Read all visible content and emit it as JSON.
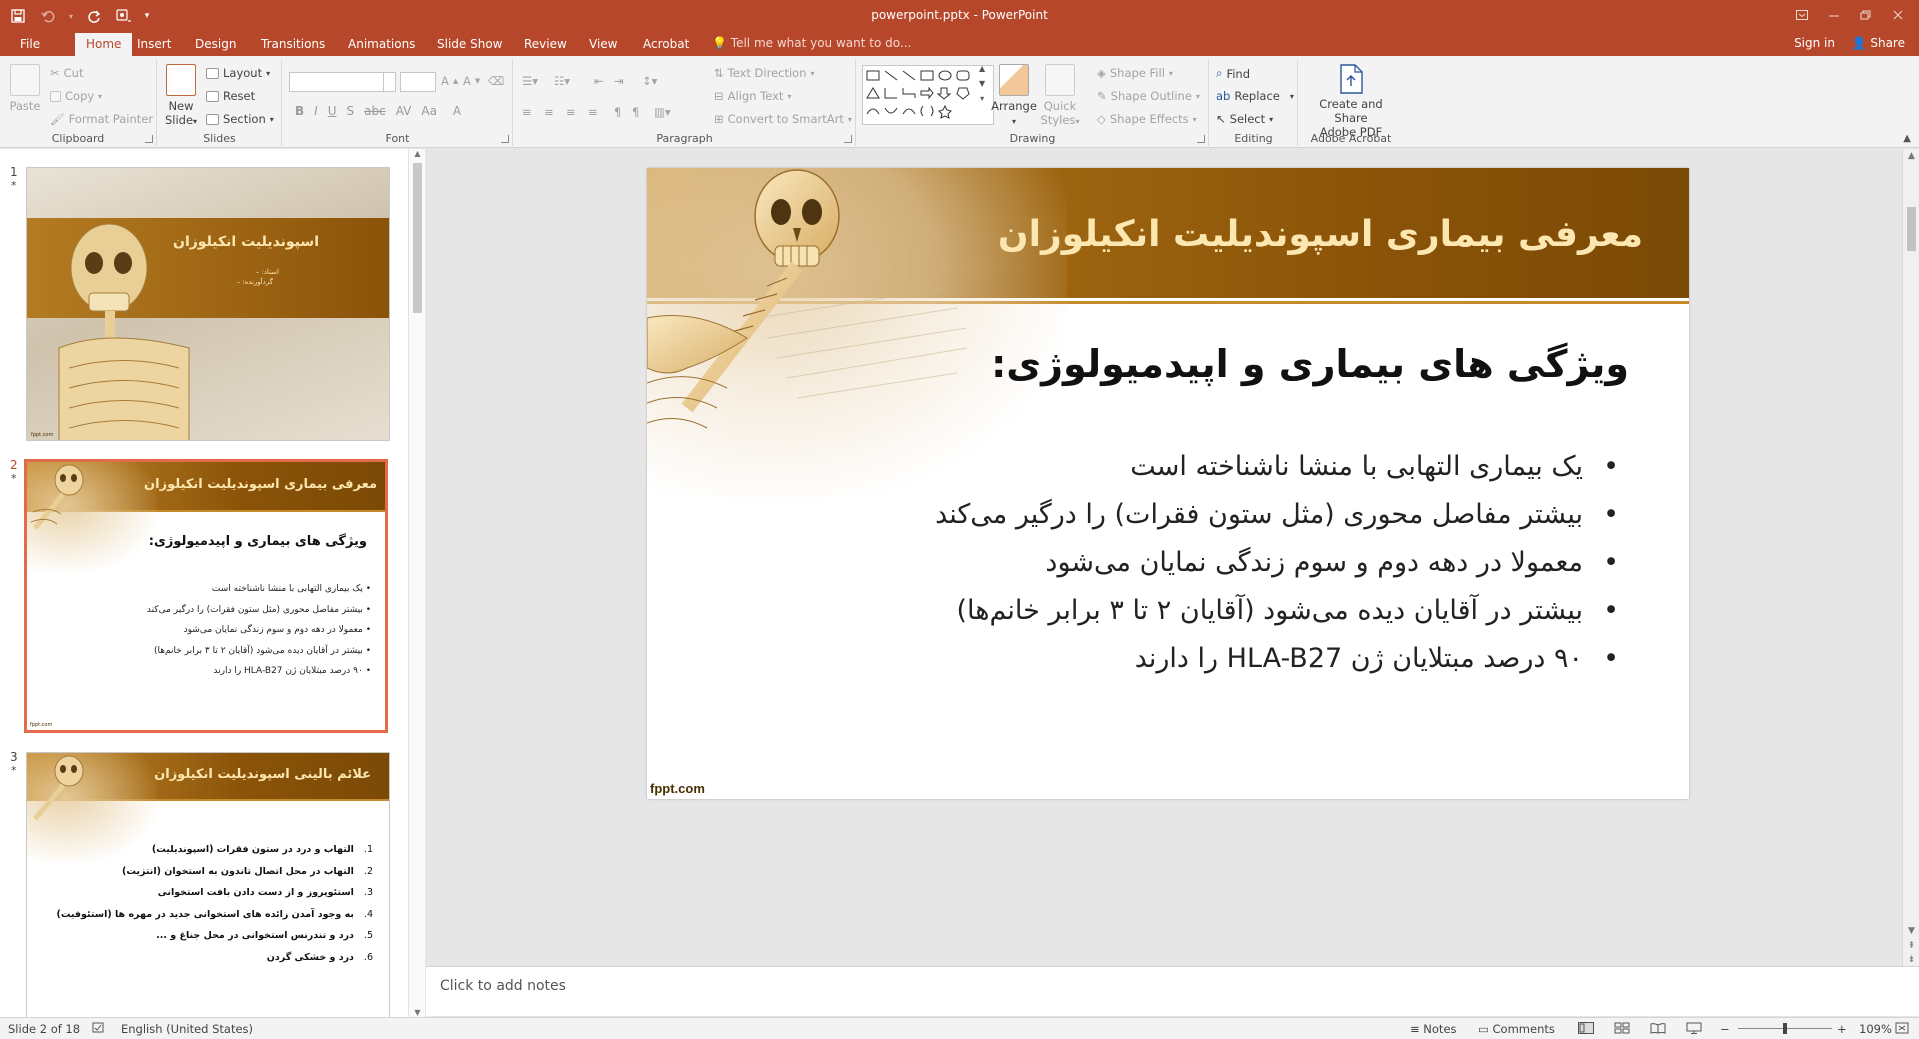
{
  "window": {
    "title": "powerpoint.pptx - PowerPoint",
    "accent": "#b7472a"
  },
  "qat": {
    "icons": [
      "save-icon",
      "undo-icon",
      "redo-icon",
      "touch-mode-icon",
      "customize-icon"
    ]
  },
  "tabs": [
    {
      "label": "File"
    },
    {
      "label": "Home"
    },
    {
      "label": "Insert"
    },
    {
      "label": "Design"
    },
    {
      "label": "Transitions"
    },
    {
      "label": "Animations"
    },
    {
      "label": "Slide Show"
    },
    {
      "label": "Review"
    },
    {
      "label": "View"
    },
    {
      "label": "Acrobat"
    }
  ],
  "active_tab": "Home",
  "tell_me": "Tell me what you want to do...",
  "account": {
    "signin": "Sign in",
    "share": "Share"
  },
  "ribbon": {
    "clipboard": {
      "label": "Clipboard",
      "paste": "Paste",
      "cut": "Cut",
      "copy": "Copy",
      "format_painter": "Format Painter"
    },
    "slides": {
      "label": "Slides",
      "new_slide_1": "New",
      "new_slide_2": "Slide",
      "layout": "Layout",
      "reset": "Reset",
      "section": "Section"
    },
    "font": {
      "label": "Font",
      "bold": "B",
      "italic": "I",
      "underline": "U",
      "strike": "S",
      "shadow": "abc",
      "spacing": "AV",
      "case": "Aa",
      "color": "A"
    },
    "paragraph": {
      "label": "Paragraph",
      "text_direction": "Text Direction",
      "align_text": "Align Text",
      "smartart": "Convert to SmartArt"
    },
    "drawing": {
      "label": "Drawing",
      "arrange": "Arrange",
      "quick_styles_1": "Quick",
      "quick_styles_2": "Styles",
      "shape_fill": "Shape Fill",
      "shape_outline": "Shape Outline",
      "shape_effects": "Shape Effects"
    },
    "editing": {
      "label": "Editing",
      "find": "Find",
      "replace": "Replace",
      "select": "Select"
    },
    "acrobat": {
      "label": "Adobe Acrobat",
      "create_1": "Create and Share",
      "create_2": "Adobe PDF"
    }
  },
  "thumbnails": [
    {
      "number": "1",
      "star": "*",
      "title": "اسپوندیلیت انکیلوزان",
      "subtitle_1": "استاد: –",
      "subtitle_2": "گردآورنده: –",
      "brand": "fppt.com"
    },
    {
      "number": "2",
      "star": "*",
      "title": "معرفی بیماری اسپوندیلیت انکیلوزان",
      "heading": "ویژگی های بیماری و اپیدمیولوژی:",
      "bullets": [
        "یک بیماری التهابی با منشا ناشناخته است",
        "بیشتر مفاصل محوری (مثل ستون فقرات) را درگیر می‌کند",
        "معمولا در دهه دوم و سوم زندگی نمایان می‌شود",
        "بیشتر در آقایان دیده می‌شود (آقایان ۲ تا ۳ برابر خانم‌ها)",
        "۹۰ درصد مبتلایان ژن HLA-B27 را دارند"
      ],
      "brand": "fppt.com"
    },
    {
      "number": "3",
      "star": "*",
      "title": "علائم بالینی اسپوندیلیت انکیلوزان",
      "items": [
        {
          "n": "1.",
          "t": "التهاب و درد در ستون فقرات (اسپوندیلیت)"
        },
        {
          "n": "2.",
          "t": "التهاب در محل اتصال تاندون به استخوان (انتزیت)"
        },
        {
          "n": "3.",
          "t": "استئوپروز و از دست دادن بافت استخوانی"
        },
        {
          "n": "4.",
          "t": "به وجود آمدن زائده های استخوانی جدید در مهره ها (استئوفیت)"
        },
        {
          "n": "5.",
          "t": "درد و تندرنس استخوانی در محل جناغ و ..."
        },
        {
          "n": "6.",
          "t": "درد و خشکی گردن"
        }
      ]
    }
  ],
  "slide": {
    "title": "معرفی بیماری اسپوندیلیت انکیلوزان",
    "heading": "ویژگی های بیماری و اپیدمیولوژی:",
    "bullets": [
      "یک بیماری التهابی با منشا ناشناخته است",
      "بیشتر مفاصل محوری (مثل ستون فقرات) را درگیر می‌کند",
      "معمولا در دهه دوم و سوم زندگی نمایان می‌شود",
      "بیشتر در آقایان دیده می‌شود (آقایان ۲ تا ۳ برابر خانم‌ها)",
      "۹۰ درصد مبتلایان ژن HLA-B27 را دارند"
    ],
    "brand": "fppt.com",
    "colors": {
      "band_dark": "#7b4a06",
      "band_light": "#c48a2c",
      "title_text": "#fde7b0"
    }
  },
  "notes_placeholder": "Click to add notes",
  "status": {
    "slide_info": "Slide 2 of 18",
    "language": "English (United States)",
    "notes": "Notes",
    "comments": "Comments",
    "zoom_minus": "−",
    "zoom_plus": "+",
    "zoom": "109%"
  }
}
